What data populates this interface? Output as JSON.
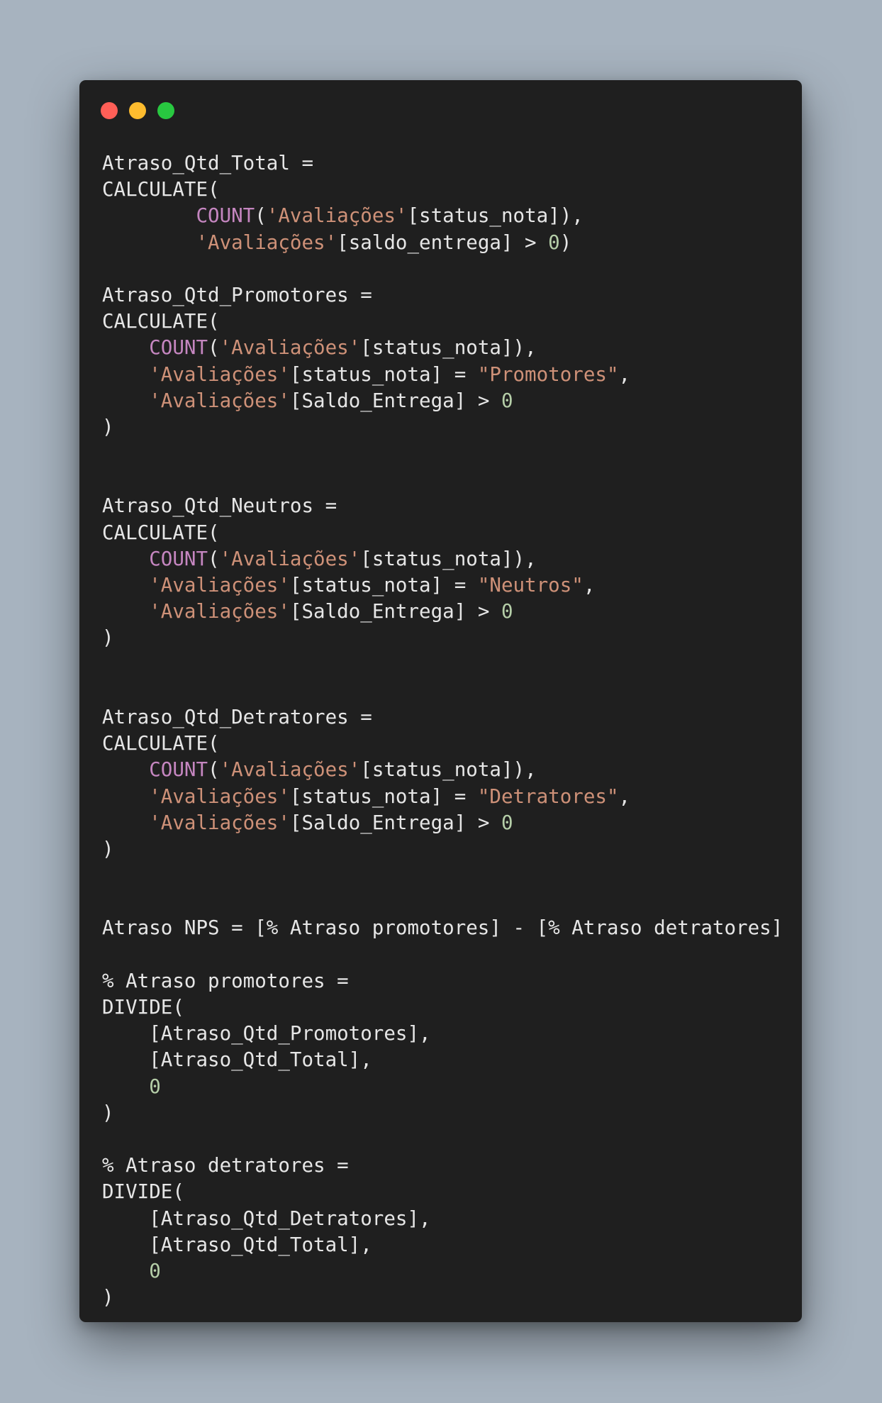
{
  "window": {
    "controls": [
      {
        "name": "close",
        "color": "#ff5f57"
      },
      {
        "name": "minimize",
        "color": "#febc2e"
      },
      {
        "name": "zoom",
        "color": "#28c840"
      }
    ]
  },
  "colors": {
    "background": "#a7b3bf",
    "editor": "#1f1f1f",
    "text": "#e6e6e6",
    "function": "#c586c0",
    "string": "#ce9178",
    "number": "#b5cea8"
  },
  "code_lines": [
    [
      {
        "t": "plain",
        "v": "Atraso_Qtd_Total ="
      }
    ],
    [
      {
        "t": "plain",
        "v": "CALCULATE("
      }
    ],
    [
      {
        "t": "plain",
        "v": "        "
      },
      {
        "t": "fn",
        "v": "COUNT"
      },
      {
        "t": "plain",
        "v": "("
      },
      {
        "t": "str",
        "v": "'Avaliações'"
      },
      {
        "t": "plain",
        "v": "[status_nota]),"
      }
    ],
    [
      {
        "t": "plain",
        "v": "        "
      },
      {
        "t": "str",
        "v": "'Avaliações'"
      },
      {
        "t": "plain",
        "v": "[saldo_entrega] > "
      },
      {
        "t": "num",
        "v": "0"
      },
      {
        "t": "plain",
        "v": ")"
      }
    ],
    [],
    [
      {
        "t": "plain",
        "v": "Atraso_Qtd_Promotores ="
      }
    ],
    [
      {
        "t": "plain",
        "v": "CALCULATE("
      }
    ],
    [
      {
        "t": "plain",
        "v": "    "
      },
      {
        "t": "fn",
        "v": "COUNT"
      },
      {
        "t": "plain",
        "v": "("
      },
      {
        "t": "str",
        "v": "'Avaliações'"
      },
      {
        "t": "plain",
        "v": "[status_nota]),"
      }
    ],
    [
      {
        "t": "plain",
        "v": "    "
      },
      {
        "t": "str",
        "v": "'Avaliações'"
      },
      {
        "t": "plain",
        "v": "[status_nota] = "
      },
      {
        "t": "str",
        "v": "\"Promotores\""
      },
      {
        "t": "plain",
        "v": ","
      }
    ],
    [
      {
        "t": "plain",
        "v": "    "
      },
      {
        "t": "str",
        "v": "'Avaliações'"
      },
      {
        "t": "plain",
        "v": "[Saldo_Entrega] > "
      },
      {
        "t": "num",
        "v": "0"
      }
    ],
    [
      {
        "t": "plain",
        "v": ")"
      }
    ],
    [],
    [],
    [
      {
        "t": "plain",
        "v": "Atraso_Qtd_Neutros ="
      }
    ],
    [
      {
        "t": "plain",
        "v": "CALCULATE("
      }
    ],
    [
      {
        "t": "plain",
        "v": "    "
      },
      {
        "t": "fn",
        "v": "COUNT"
      },
      {
        "t": "plain",
        "v": "("
      },
      {
        "t": "str",
        "v": "'Avaliações'"
      },
      {
        "t": "plain",
        "v": "[status_nota]),"
      }
    ],
    [
      {
        "t": "plain",
        "v": "    "
      },
      {
        "t": "str",
        "v": "'Avaliações'"
      },
      {
        "t": "plain",
        "v": "[status_nota] = "
      },
      {
        "t": "str",
        "v": "\"Neutros\""
      },
      {
        "t": "plain",
        "v": ","
      }
    ],
    [
      {
        "t": "plain",
        "v": "    "
      },
      {
        "t": "str",
        "v": "'Avaliações'"
      },
      {
        "t": "plain",
        "v": "[Saldo_Entrega] > "
      },
      {
        "t": "num",
        "v": "0"
      }
    ],
    [
      {
        "t": "plain",
        "v": ")"
      }
    ],
    [],
    [],
    [
      {
        "t": "plain",
        "v": "Atraso_Qtd_Detratores ="
      }
    ],
    [
      {
        "t": "plain",
        "v": "CALCULATE("
      }
    ],
    [
      {
        "t": "plain",
        "v": "    "
      },
      {
        "t": "fn",
        "v": "COUNT"
      },
      {
        "t": "plain",
        "v": "("
      },
      {
        "t": "str",
        "v": "'Avaliações'"
      },
      {
        "t": "plain",
        "v": "[status_nota]),"
      }
    ],
    [
      {
        "t": "plain",
        "v": "    "
      },
      {
        "t": "str",
        "v": "'Avaliações'"
      },
      {
        "t": "plain",
        "v": "[status_nota] = "
      },
      {
        "t": "str",
        "v": "\"Detratores\""
      },
      {
        "t": "plain",
        "v": ","
      }
    ],
    [
      {
        "t": "plain",
        "v": "    "
      },
      {
        "t": "str",
        "v": "'Avaliações'"
      },
      {
        "t": "plain",
        "v": "[Saldo_Entrega] > "
      },
      {
        "t": "num",
        "v": "0"
      }
    ],
    [
      {
        "t": "plain",
        "v": ")"
      }
    ],
    [],
    [],
    [
      {
        "t": "plain",
        "v": "Atraso NPS = [% Atraso promotores] - [% Atraso detratores]"
      }
    ],
    [],
    [
      {
        "t": "plain",
        "v": "% Atraso promotores ="
      }
    ],
    [
      {
        "t": "plain",
        "v": "DIVIDE("
      }
    ],
    [
      {
        "t": "plain",
        "v": "    [Atraso_Qtd_Promotores],"
      }
    ],
    [
      {
        "t": "plain",
        "v": "    [Atraso_Qtd_Total],"
      }
    ],
    [
      {
        "t": "plain",
        "v": "    "
      },
      {
        "t": "num",
        "v": "0"
      }
    ],
    [
      {
        "t": "plain",
        "v": ")"
      }
    ],
    [],
    [
      {
        "t": "plain",
        "v": "% Atraso detratores ="
      }
    ],
    [
      {
        "t": "plain",
        "v": "DIVIDE("
      }
    ],
    [
      {
        "t": "plain",
        "v": "    [Atraso_Qtd_Detratores],"
      }
    ],
    [
      {
        "t": "plain",
        "v": "    [Atraso_Qtd_Total],"
      }
    ],
    [
      {
        "t": "plain",
        "v": "    "
      },
      {
        "t": "num",
        "v": "0"
      }
    ],
    [
      {
        "t": "plain",
        "v": ")"
      }
    ]
  ]
}
